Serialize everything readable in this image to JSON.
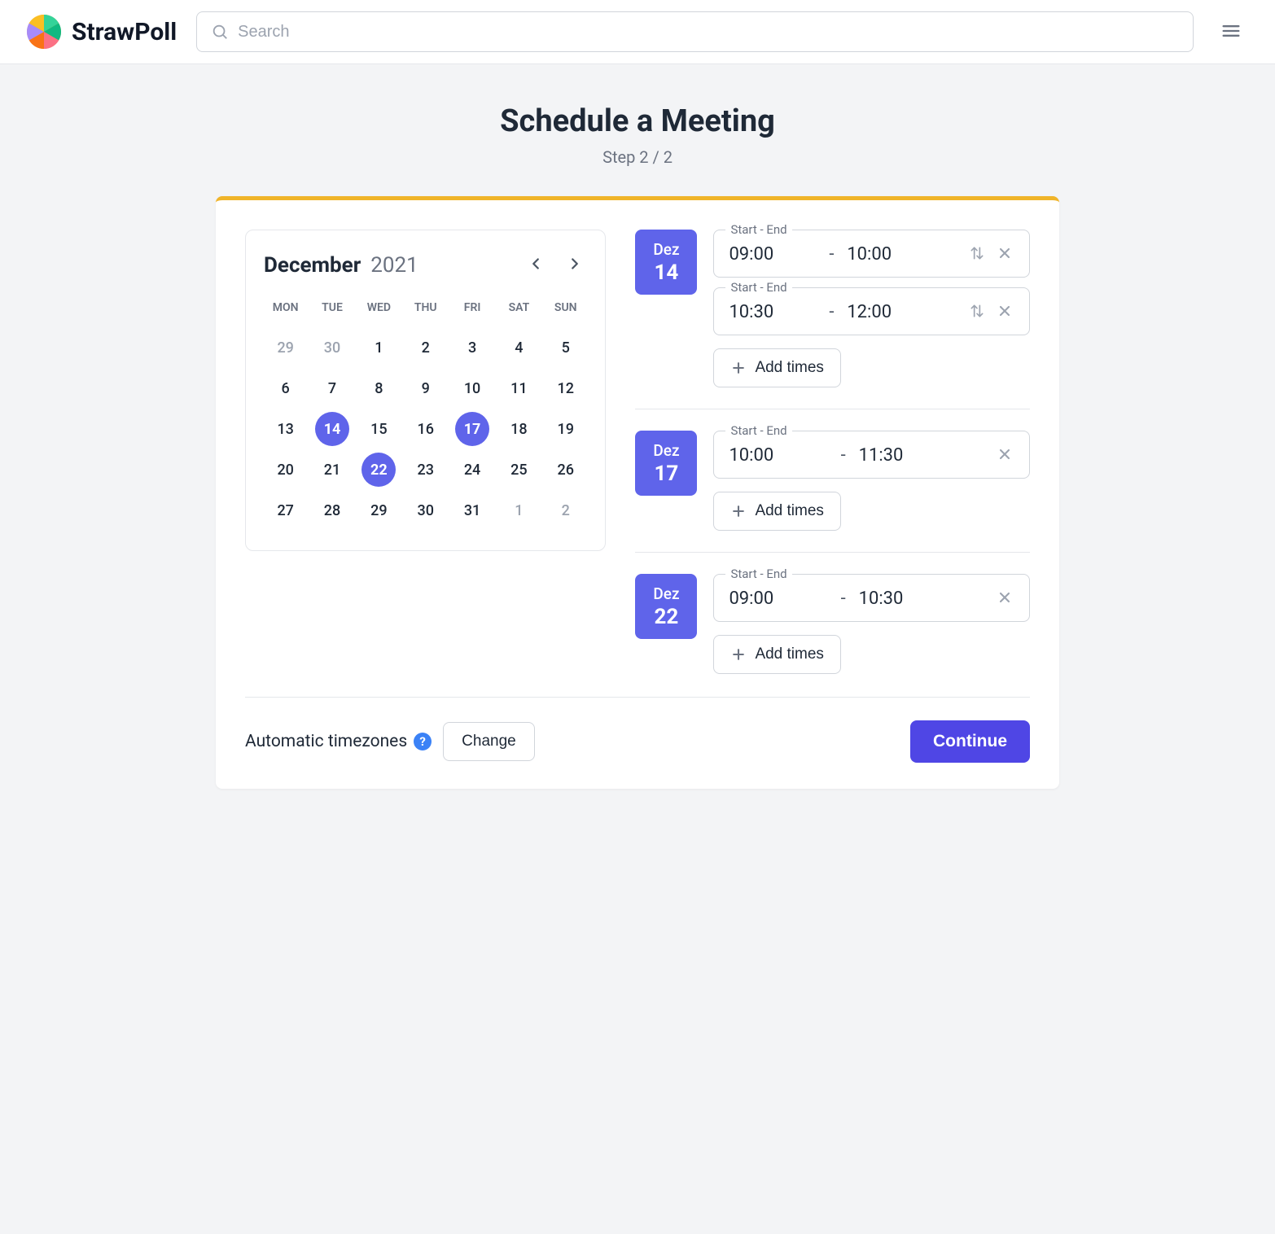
{
  "header": {
    "brand": "StrawPoll",
    "search_placeholder": "Search"
  },
  "page": {
    "title": "Schedule a Meeting",
    "subtitle": "Step 2 / 2"
  },
  "calendar": {
    "month": "December",
    "year": "2021",
    "dow": [
      "MON",
      "TUE",
      "WED",
      "THU",
      "FRI",
      "SAT",
      "SUN"
    ],
    "cells": [
      {
        "d": "29",
        "muted": true
      },
      {
        "d": "30",
        "muted": true
      },
      {
        "d": "1"
      },
      {
        "d": "2"
      },
      {
        "d": "3"
      },
      {
        "d": "4"
      },
      {
        "d": "5"
      },
      {
        "d": "6"
      },
      {
        "d": "7"
      },
      {
        "d": "8"
      },
      {
        "d": "9"
      },
      {
        "d": "10"
      },
      {
        "d": "11"
      },
      {
        "d": "12"
      },
      {
        "d": "13"
      },
      {
        "d": "14",
        "selected": true
      },
      {
        "d": "15"
      },
      {
        "d": "16"
      },
      {
        "d": "17",
        "selected": true
      },
      {
        "d": "18"
      },
      {
        "d": "19"
      },
      {
        "d": "20"
      },
      {
        "d": "21"
      },
      {
        "d": "22",
        "selected": true
      },
      {
        "d": "23"
      },
      {
        "d": "24"
      },
      {
        "d": "25"
      },
      {
        "d": "26"
      },
      {
        "d": "27"
      },
      {
        "d": "28"
      },
      {
        "d": "29"
      },
      {
        "d": "30"
      },
      {
        "d": "31"
      },
      {
        "d": "1",
        "muted": true
      },
      {
        "d": "2",
        "muted": true
      }
    ]
  },
  "slots": {
    "legend": "Start - End",
    "add_label": "Add times",
    "dates": [
      {
        "badge_month": "Dez",
        "badge_day": "14",
        "entries": [
          {
            "start": "09:00",
            "end": "10:00",
            "copyable": true
          },
          {
            "start": "10:30",
            "end": "12:00",
            "copyable": true
          }
        ]
      },
      {
        "badge_month": "Dez",
        "badge_day": "17",
        "entries": [
          {
            "start": "10:00",
            "end": "11:30",
            "copyable": false
          }
        ]
      },
      {
        "badge_month": "Dez",
        "badge_day": "22",
        "entries": [
          {
            "start": "09:00",
            "end": "10:30",
            "copyable": false
          }
        ]
      }
    ]
  },
  "footer": {
    "tz_label": "Automatic timezones",
    "tz_info": "?",
    "change_label": "Change",
    "continue_label": "Continue"
  }
}
